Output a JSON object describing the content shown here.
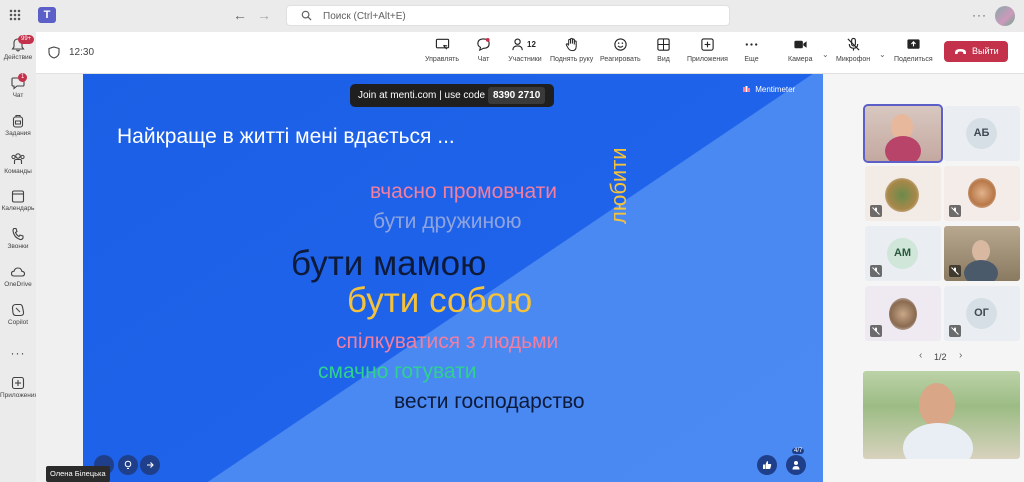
{
  "search": {
    "placeholder": "Поиск (Ctrl+Alt+E)"
  },
  "rail": {
    "items": [
      {
        "label": "Действие",
        "badge": "99+"
      },
      {
        "label": "Чат",
        "badge": "1"
      },
      {
        "label": "Задания"
      },
      {
        "label": "Команды"
      },
      {
        "label": "Календарь"
      },
      {
        "label": "Звонки"
      },
      {
        "label": "OneDrive"
      },
      {
        "label": "Copilot"
      },
      {
        "label": "Приложения"
      }
    ]
  },
  "meeting": {
    "time": "12:30",
    "toolbar": {
      "manage": "Управлять",
      "chat": "Чат",
      "participants": "Участники",
      "participants_count": "12",
      "raise_hand": "Поднять руку",
      "react": "Реагировать",
      "view": "Вид",
      "apps": "Приложения",
      "more": "Еще",
      "camera": "Камера",
      "mic": "Микрофон",
      "share": "Поделиться",
      "leave": "Выйти"
    }
  },
  "presentation": {
    "join_text": "Join at menti.com | use code",
    "code": "8390 2710",
    "brand": "Mentimeter",
    "question": "Найкраще в житті мені вдається ...",
    "words": [
      {
        "text": "вчасно промовчати",
        "color": "#f27ea0"
      },
      {
        "text": "бути дружиною",
        "color": "#8fa4df"
      },
      {
        "text": "бути мамою",
        "color": "#0d1a3a"
      },
      {
        "text": "бути собою",
        "color": "#f5c33b"
      },
      {
        "text": "любити",
        "color": "#f5c33b"
      },
      {
        "text": "спілкуватися з людьми",
        "color": "#f27ea0"
      },
      {
        "text": "смачно готувати",
        "color": "#2fd18f"
      },
      {
        "text": "вести господарство",
        "color": "#0d1a3a"
      }
    ],
    "count_badge": "4/7"
  },
  "speaker_name": "Олена Білецька",
  "participants": {
    "tiles": [
      {
        "initials": ""
      },
      {
        "initials": "АБ"
      },
      {
        "initials": ""
      },
      {
        "initials": ""
      },
      {
        "initials": "АМ"
      },
      {
        "initials": ""
      },
      {
        "initials": ""
      },
      {
        "initials": "ОГ"
      }
    ],
    "page": "1/2"
  }
}
